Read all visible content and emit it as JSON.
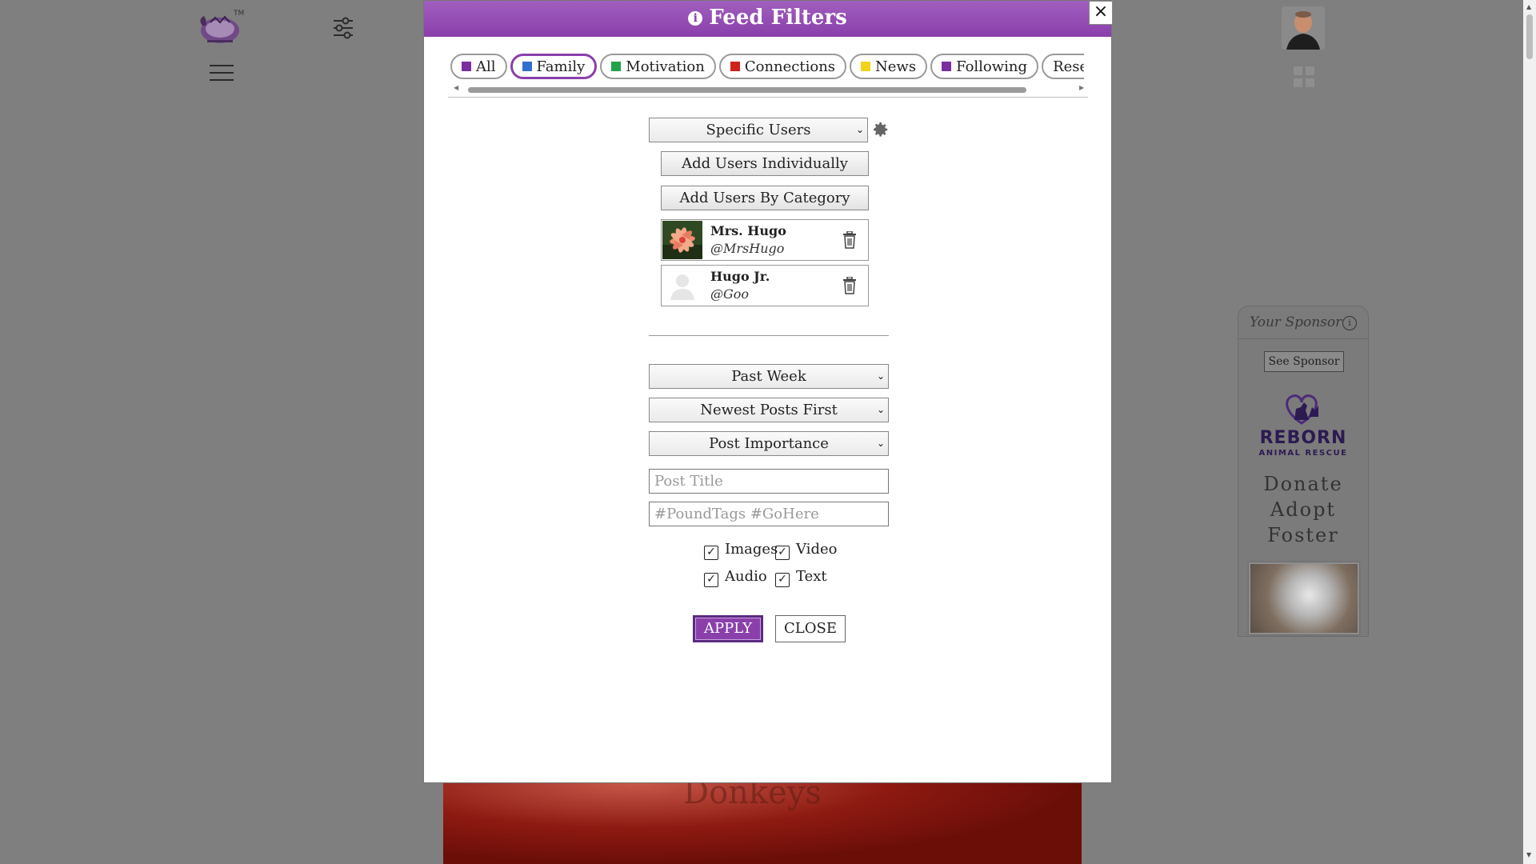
{
  "background": {
    "trademark": "TM",
    "post_ghost_text": "Donkeys"
  },
  "sponsor": {
    "label": "Your Sponsor",
    "info": "i",
    "see_button": "See Sponsor",
    "brand_line1": "REBORN",
    "brand_line2": "ANIMAL RESCUE",
    "cta": [
      "Donate",
      "Adopt",
      "Foster"
    ]
  },
  "modal": {
    "title": "Feed Filters",
    "info": "i",
    "close_x": "×",
    "tabs": [
      {
        "label": "All",
        "color": "#7b2f9e",
        "selected": false
      },
      {
        "label": "Family",
        "color": "#2f6fd0",
        "selected": true
      },
      {
        "label": "Motivation",
        "color": "#22a24a",
        "selected": false
      },
      {
        "label": "Connections",
        "color": "#d0211d",
        "selected": false
      },
      {
        "label": "News",
        "color": "#f4d21a",
        "selected": false
      },
      {
        "label": "Following",
        "color": "#7b2f9e",
        "selected": false
      },
      {
        "label": "Reset Filters",
        "color": null,
        "selected": false
      }
    ],
    "user_scope": "Specific Users",
    "add_individually": "Add Users Individually",
    "add_by_category": "Add Users By Category",
    "users": [
      {
        "name": "Mrs. Hugo",
        "handle": "@MrsHugo"
      },
      {
        "name": "Hugo Jr.",
        "handle": "@Goo"
      }
    ],
    "time_range": "Past Week",
    "sort_order": "Newest Posts First",
    "sort_by": "Post Importance",
    "post_title_placeholder": "Post Title",
    "tags_placeholder": "#PoundTags #GoHere",
    "media": {
      "images": {
        "label": "Images",
        "checked": true
      },
      "video": {
        "label": "Video",
        "checked": true
      },
      "audio": {
        "label": "Audio",
        "checked": true
      },
      "text": {
        "label": "Text",
        "checked": true
      }
    },
    "check_mark": "✓",
    "caret": "⌄",
    "apply": "APPLY",
    "close": "CLOSE"
  },
  "colors": {
    "accent": "#8a3fab",
    "header": "#9b52bb"
  }
}
